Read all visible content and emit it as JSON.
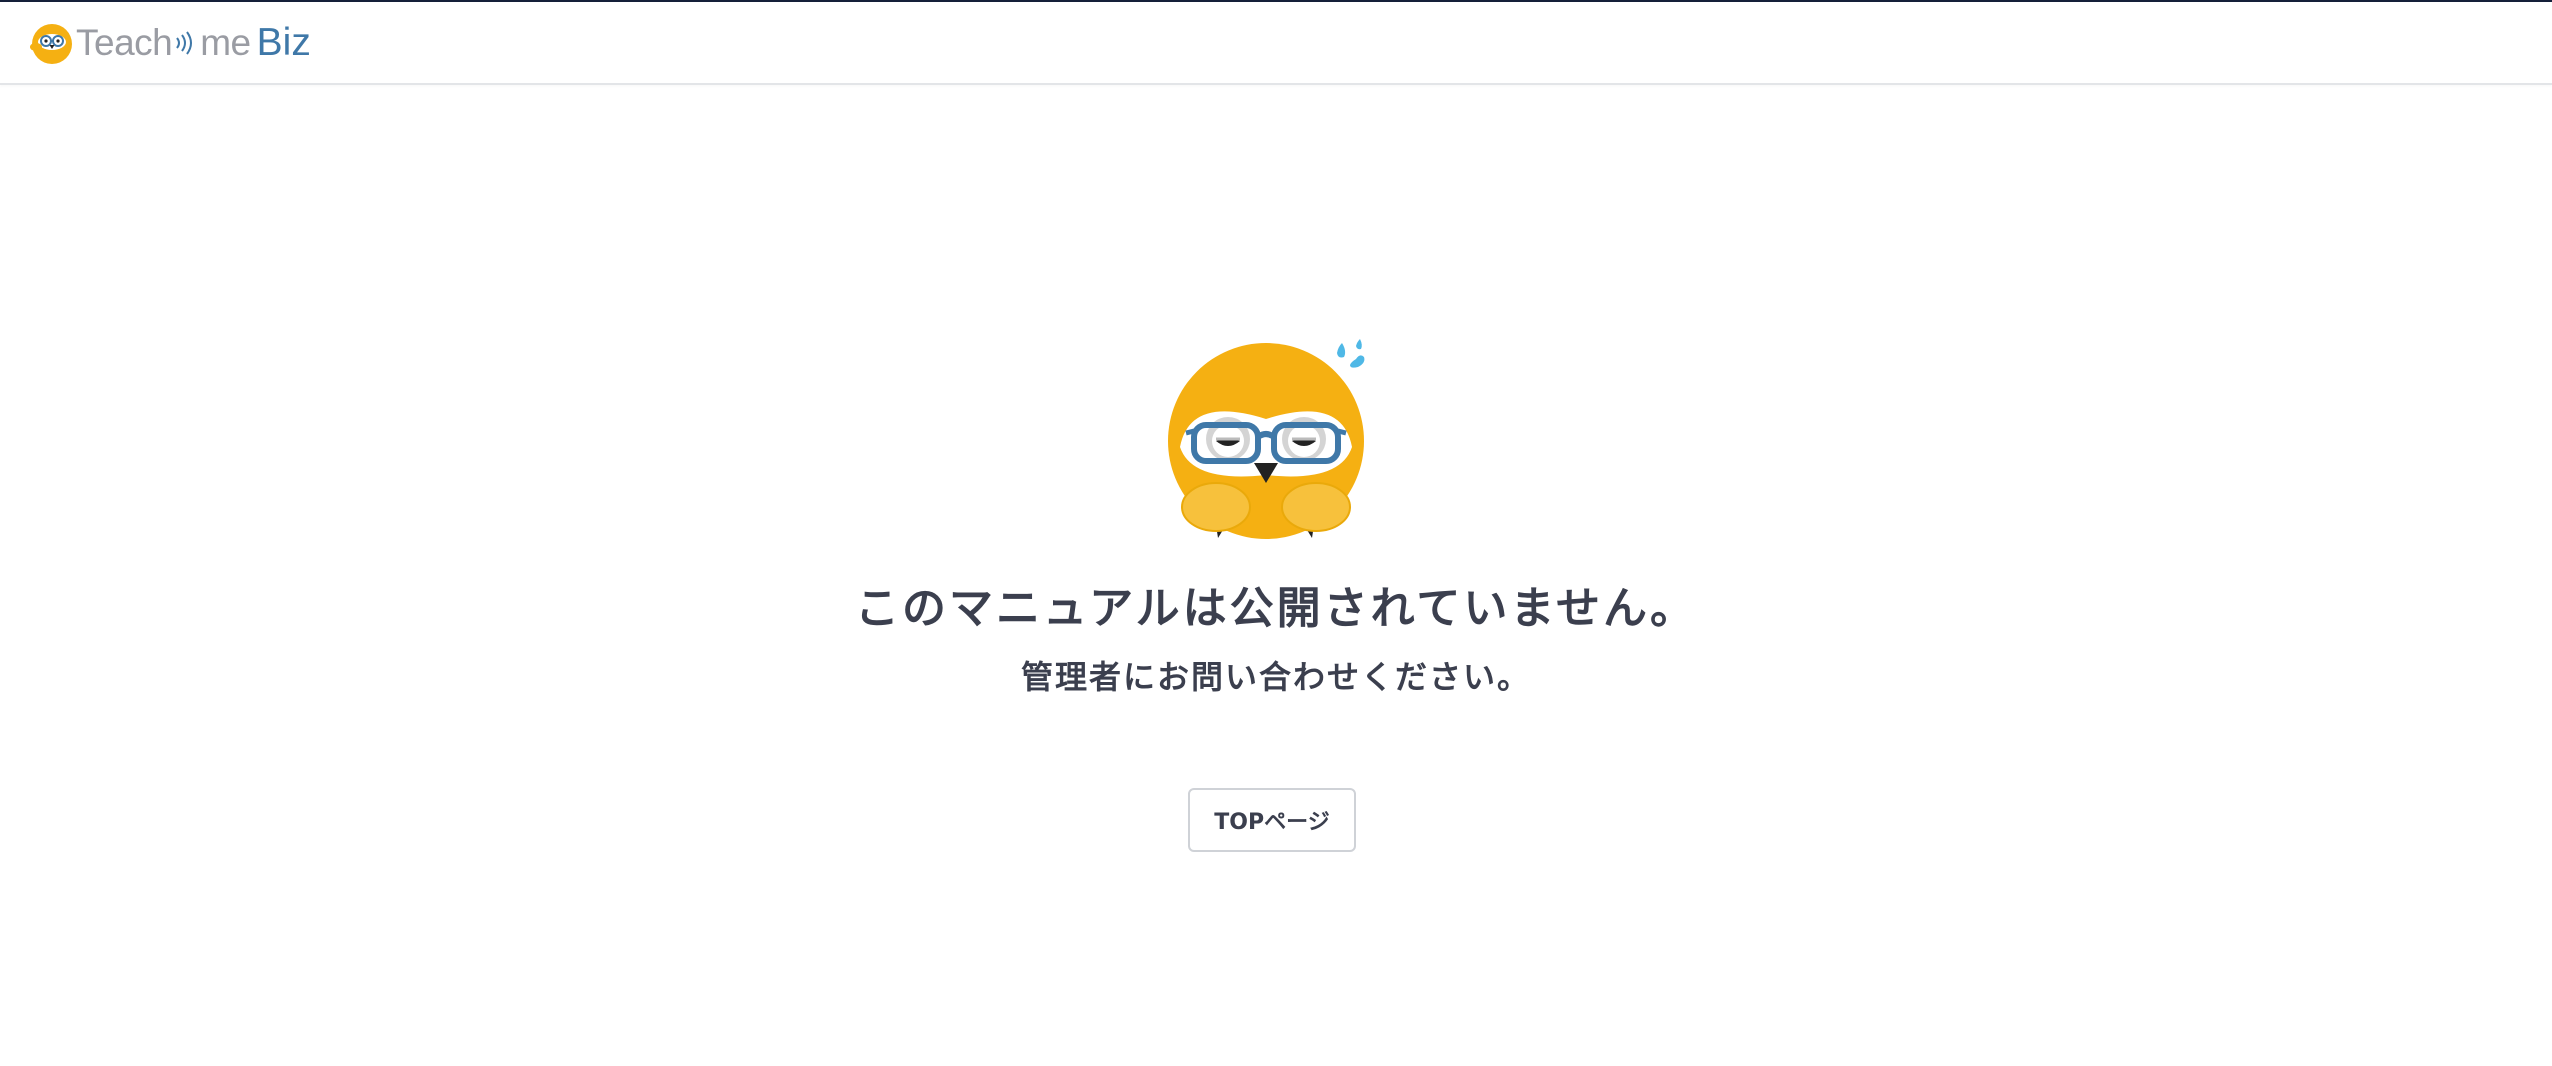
{
  "header": {
    "logo": {
      "part1": "Teach",
      "part2": "me",
      "part3": "Biz"
    }
  },
  "message": {
    "title": "このマニュアルは公開されていません。",
    "subtitle": "管理者にお問い合わせください。"
  },
  "actions": {
    "top_button_label": "TOPページ"
  },
  "colors": {
    "brand_yellow": "#f5b012",
    "brand_blue": "#3f78a8",
    "text": "#3b3f4e"
  }
}
